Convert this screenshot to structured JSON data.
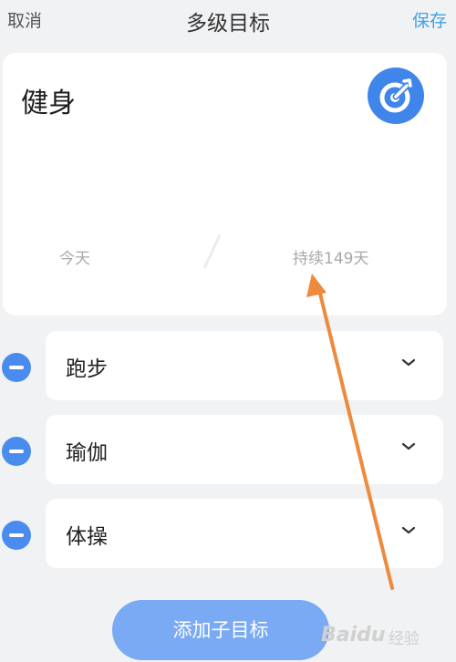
{
  "header": {
    "cancel_label": "取消",
    "title": "多级目标",
    "save_label": "保存"
  },
  "goal": {
    "name": "健身",
    "icon": "target-icon",
    "start_label": "今天",
    "duration_label": "持续149天"
  },
  "sub_goals": [
    {
      "label": "跑步"
    },
    {
      "label": "瑜伽"
    },
    {
      "label": "体操"
    }
  ],
  "add_button_label": "添加子目标",
  "watermark": {
    "brand": "Baidu",
    "text": "经验"
  },
  "colors": {
    "accent_blue": "#3f85ea",
    "save_blue": "#3ea2e8",
    "add_button": "#7aaaf4",
    "annotation_arrow": "#ee8a3c",
    "background": "#f1f2f4"
  }
}
